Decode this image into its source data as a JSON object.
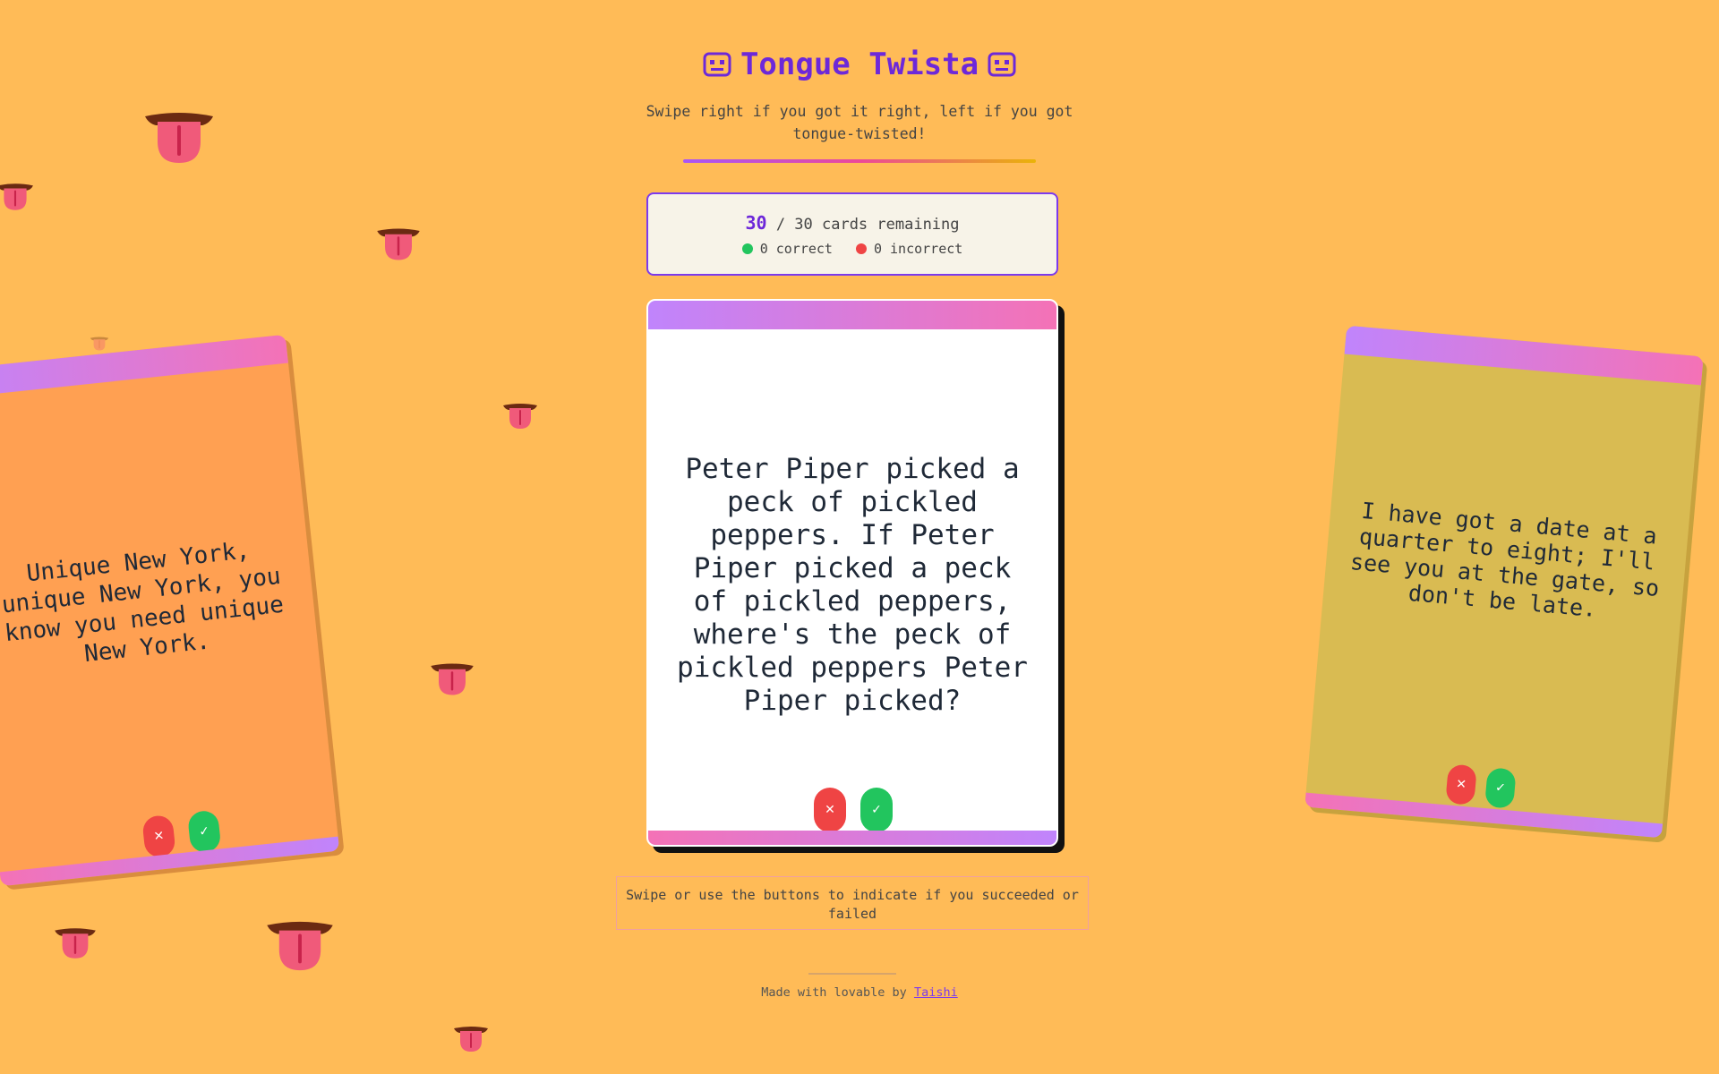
{
  "header": {
    "title": "Tongue Twista",
    "subtitle": "Swipe right if you got it right, left if you got tongue-twisted!"
  },
  "counter": {
    "remaining": "30",
    "total_text": "/ 30 cards remaining",
    "correct_text": "0 correct",
    "incorrect_text": "0 incorrect"
  },
  "cards": {
    "current": {
      "text": "Peter Piper picked a peck of pickled peppers. If Peter Piper picked a peck of pickled peppers, where's the peck of pickled peppers Peter Piper picked?",
      "fail_label": "✕",
      "success_label": "✓"
    },
    "left": {
      "text": "Unique New York, unique New York, you know you need unique New York.",
      "fail_label": "✕",
      "success_label": "✓"
    },
    "right": {
      "text": "I have got a date at a quarter to eight; I'll see you at the gate, so don't be late.",
      "fail_label": "✕",
      "success_label": "✓"
    }
  },
  "hint": "Swipe or use the buttons to indicate if you succeeded or failed",
  "footer": {
    "prefix": "Made with lovable by",
    "author": "Taishi"
  },
  "colors": {
    "background": "#ffbb57",
    "accent": "#6d28d9",
    "success": "#22c55e",
    "fail": "#ef4444",
    "tongue": "#f05a7a",
    "mouth": "#6b2a12"
  },
  "icons": {
    "title_decor": "robot-face-icon",
    "decoration": "tongue-icon"
  }
}
